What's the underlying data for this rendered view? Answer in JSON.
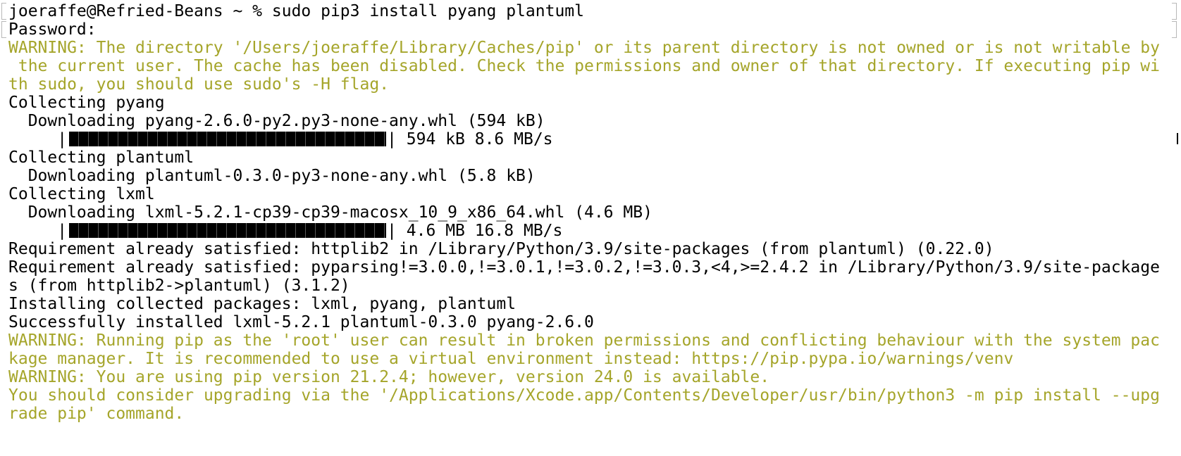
{
  "terminal": {
    "prompt": "joeraffe@Refried-Beans ~ % ",
    "command": "sudo pip3 install pyang plantuml",
    "password_prompt": "Password:",
    "lines": {
      "warn_cache_1": "WARNING: The directory '/Users/joeraffe/Library/Caches/pip' or its parent directory is not owned or is not writable by",
      "warn_cache_2": " the current user. The cache has been disabled. Check the permissions and owner of that directory. If executing pip wi",
      "warn_cache_3": "th sudo, you should use sudo's -H flag.",
      "collect_pyang": "Collecting pyang",
      "download_pyang": "  Downloading pyang-2.6.0-py2.py3-none-any.whl (594 kB)",
      "progress_pyang_stats": " 594 kB 8.6 MB/s",
      "collect_plantuml": "Collecting plantuml",
      "download_plantuml": "  Downloading plantuml-0.3.0-py3-none-any.whl (5.8 kB)",
      "collect_lxml": "Collecting lxml",
      "download_lxml": "  Downloading lxml-5.2.1-cp39-cp39-macosx_10_9_x86_64.whl (4.6 MB)",
      "progress_lxml_stats": " 4.6 MB 16.8 MB/s",
      "req_httplib2": "Requirement already satisfied: httplib2 in /Library/Python/3.9/site-packages (from plantuml) (0.22.0)",
      "req_pyparsing_1": "Requirement already satisfied: pyparsing!=3.0.0,!=3.0.1,!=3.0.2,!=3.0.3,<4,>=2.4.2 in /Library/Python/3.9/site-package",
      "req_pyparsing_2": "s (from httplib2->plantuml) (3.1.2)",
      "installing": "Installing collected packages: lxml, pyang, plantuml",
      "success": "Successfully installed lxml-5.2.1 plantuml-0.3.0 pyang-2.6.0",
      "warn_root_1": "WARNING: Running pip as the 'root' user can result in broken permissions and conflicting behaviour with the system pac",
      "warn_root_2": "kage manager. It is recommended to use a virtual environment instead: https://pip.pypa.io/warnings/venv",
      "warn_version": "WARNING: You are using pip version 21.2.4; however, version 24.0 is available.",
      "upgrade_1": "You should consider upgrading via the '/Applications/Xcode.app/Contents/Developer/usr/bin/python3 -m pip install --upg",
      "upgrade_2": "rade pip' command."
    },
    "progress": {
      "indent": "     |",
      "end": "|",
      "pyang_fraction": 1.0,
      "lxml_fraction": 1.0
    },
    "colors": {
      "background": "#ffffff",
      "text": "#000000",
      "warning": "#a5a52a"
    }
  }
}
